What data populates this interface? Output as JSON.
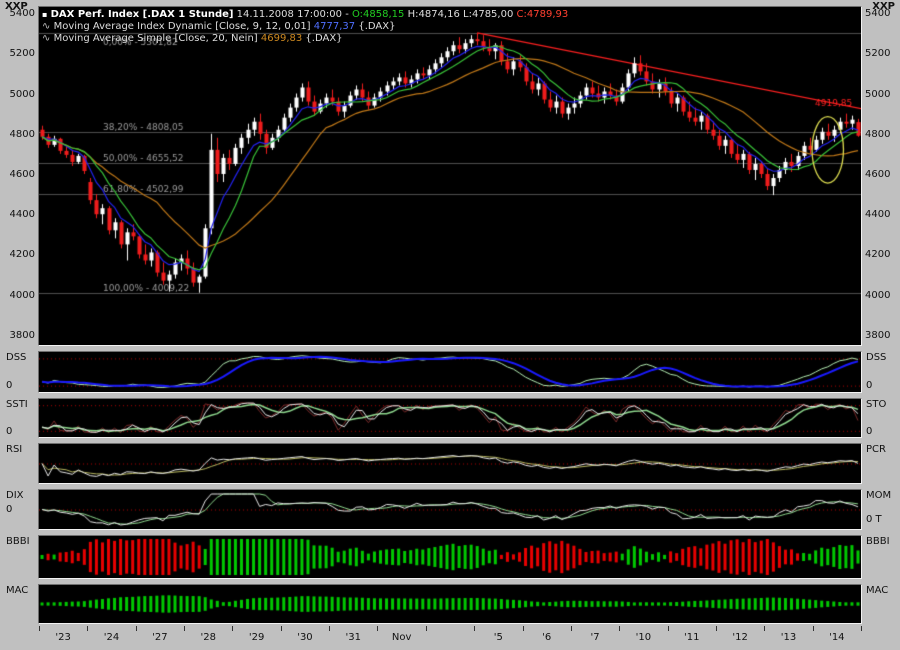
{
  "window": {
    "corner_label": "XXP"
  },
  "icons": {
    "chart": "▪",
    "wave": "∿"
  },
  "header": {
    "title": "DAX Perf. Index [.DAX 1 Stunde]",
    "datetime": "14.11.2008 17:00:00",
    "separator": "-",
    "open": "O:4858,15",
    "high": "H:4874,16",
    "low": "L:4785,00",
    "close": "C:4789,93",
    "ma1": {
      "name": "Moving Average Index Dynamic [Close, 9, 12, 0,01]",
      "value": "4777,37",
      "suffix": "{.DAX}"
    },
    "ma2": {
      "name": "Moving Average Simple [Close, 20, Nein]",
      "value": "4699,83",
      "suffix": "{.DAX}"
    }
  },
  "panel_labels": {
    "zero": "0",
    "dss_left": "DSS",
    "dss_right": "DSS",
    "ssti_left": "SSTI",
    "ssti_right": "STO",
    "rsi_left": "RSI",
    "rsi_right": "PCR",
    "dix_left": "DIX",
    "dix_right": "MOM",
    "dix_right_zero": "0 T",
    "bbbi_left": "BBBI",
    "bbbi_right": "BBBI",
    "mac_left": "MAC",
    "mac_right": "MAC"
  },
  "colors": {
    "background": "#c0c0c0",
    "panel_bg": "#000000",
    "up_candle": "#ffffff",
    "down_candle": "#ee1c1c",
    "ma_fast_blue": "#2222ee",
    "ma_mid_green": "#38c038",
    "ma_slow_orange": "#c07818",
    "fib_line": "#4f4f4f",
    "fib_text": "#9a9a9a",
    "trend": "#ff2020",
    "ellipse": "#dcdc50",
    "dss_blue": "#1a1aff",
    "dss_green": "#b4eeb4",
    "osc_white": "#e6e6e6",
    "osc_green": "#8ed88e",
    "osc_darkred": "#7a2a2a",
    "rsi_second": "#b8b860",
    "hist_green": "#00c800",
    "hist_red": "#e80000",
    "dotted": "#b00000"
  },
  "chart_data": {
    "type": "candlestick",
    "title": "DAX Perf. Index [.DAX 1 Stunde]",
    "interval": "1 Stunde",
    "last_ohlc": {
      "open": 4858.15,
      "high": 4874.16,
      "low": 4785.0,
      "close": 4789.93
    },
    "ylim": [
      3800,
      5400
    ],
    "y_ticks": [
      5400,
      5200,
      5000,
      4800,
      4600,
      4400,
      4200,
      4000,
      3800
    ],
    "candles_per_day": 8,
    "x_labels": [
      {
        "day": 0,
        "text": "'23"
      },
      {
        "day": 1,
        "text": "'24"
      },
      {
        "day": 2,
        "text": "'27"
      },
      {
        "day": 3,
        "text": "'28"
      },
      {
        "day": 4,
        "text": "'29"
      },
      {
        "day": 5,
        "text": "'30"
      },
      {
        "day": 6,
        "text": "'31"
      },
      {
        "day": 7,
        "text": "Nov"
      },
      {
        "day": 9,
        "text": "'5"
      },
      {
        "day": 10,
        "text": "'6"
      },
      {
        "day": 11,
        "text": "'7"
      },
      {
        "day": 12,
        "text": "'10"
      },
      {
        "day": 13,
        "text": "'11"
      },
      {
        "day": 14,
        "text": "'12"
      },
      {
        "day": 15,
        "text": "'13"
      },
      {
        "day": 16,
        "text": "'14"
      }
    ],
    "candles": [
      [
        4820,
        4840,
        4770,
        4785
      ],
      [
        4785,
        4800,
        4730,
        4745
      ],
      [
        4745,
        4790,
        4735,
        4775
      ],
      [
        4775,
        4780,
        4700,
        4715
      ],
      [
        4715,
        4745,
        4680,
        4695
      ],
      [
        4695,
        4720,
        4640,
        4660
      ],
      [
        4660,
        4700,
        4650,
        4690
      ],
      [
        4690,
        4695,
        4600,
        4615
      ],
      [
        4560,
        4580,
        4450,
        4470
      ],
      [
        4470,
        4500,
        4380,
        4400
      ],
      [
        4400,
        4450,
        4350,
        4430
      ],
      [
        4430,
        4440,
        4300,
        4320
      ],
      [
        4320,
        4380,
        4280,
        4360
      ],
      [
        4360,
        4370,
        4230,
        4250
      ],
      [
        4250,
        4330,
        4170,
        4310
      ],
      [
        4310,
        4350,
        4270,
        4290
      ],
      [
        4290,
        4300,
        4180,
        4200
      ],
      [
        4200,
        4250,
        4150,
        4170
      ],
      [
        4170,
        4230,
        4140,
        4210
      ],
      [
        4210,
        4220,
        4090,
        4110
      ],
      [
        4110,
        4160,
        4050,
        4070
      ],
      [
        4070,
        4120,
        4015,
        4100
      ],
      [
        4100,
        4180,
        4080,
        4160
      ],
      [
        4160,
        4200,
        4120,
        4180
      ],
      [
        4180,
        4220,
        4100,
        4130
      ],
      [
        4130,
        4160,
        4040,
        4060
      ],
      [
        4060,
        4100,
        4010,
        4090
      ],
      [
        4090,
        4350,
        4080,
        4330
      ],
      [
        4330,
        4800,
        4300,
        4720
      ],
      [
        4720,
        4780,
        4560,
        4600
      ],
      [
        4600,
        4700,
        4560,
        4680
      ],
      [
        4680,
        4720,
        4620,
        4650
      ],
      [
        4650,
        4750,
        4640,
        4730
      ],
      [
        4730,
        4800,
        4700,
        4780
      ],
      [
        4780,
        4850,
        4750,
        4820
      ],
      [
        4820,
        4880,
        4790,
        4860
      ],
      [
        4860,
        4900,
        4770,
        4800
      ],
      [
        4800,
        4820,
        4700,
        4730
      ],
      [
        4730,
        4800,
        4720,
        4780
      ],
      [
        4780,
        4840,
        4760,
        4820
      ],
      [
        4820,
        4900,
        4810,
        4880
      ],
      [
        4880,
        4950,
        4860,
        4930
      ],
      [
        4930,
        5000,
        4910,
        4980
      ],
      [
        4980,
        5050,
        4960,
        5030
      ],
      [
        5030,
        5060,
        4940,
        4960
      ],
      [
        4960,
        4990,
        4890,
        4910
      ],
      [
        4910,
        4970,
        4900,
        4950
      ],
      [
        4950,
        5000,
        4930,
        4980
      ],
      [
        4980,
        5020,
        4940,
        4960
      ],
      [
        4960,
        4980,
        4890,
        4910
      ],
      [
        4910,
        4960,
        4880,
        4940
      ],
      [
        4940,
        5010,
        4930,
        4990
      ],
      [
        4990,
        5040,
        4970,
        5020
      ],
      [
        5020,
        5050,
        4960,
        4980
      ],
      [
        4980,
        5010,
        4920,
        4940
      ],
      [
        4940,
        5000,
        4930,
        4980
      ],
      [
        4980,
        5030,
        4960,
        5010
      ],
      [
        5010,
        5060,
        4990,
        5040
      ],
      [
        5040,
        5080,
        5020,
        5060
      ],
      [
        5060,
        5100,
        5040,
        5080
      ],
      [
        5080,
        5110,
        5030,
        5050
      ],
      [
        5050,
        5090,
        5030,
        5070
      ],
      [
        5070,
        5120,
        5050,
        5100
      ],
      [
        5100,
        5130,
        5070,
        5090
      ],
      [
        5090,
        5140,
        5070,
        5120
      ],
      [
        5120,
        5170,
        5100,
        5150
      ],
      [
        5150,
        5200,
        5130,
        5180
      ],
      [
        5180,
        5230,
        5160,
        5210
      ],
      [
        5210,
        5260,
        5190,
        5240
      ],
      [
        5240,
        5280,
        5200,
        5220
      ],
      [
        5220,
        5270,
        5200,
        5250
      ],
      [
        5250,
        5290,
        5230,
        5270
      ],
      [
        5270,
        5301,
        5240,
        5260
      ],
      [
        5260,
        5290,
        5210,
        5230
      ],
      [
        5230,
        5270,
        5190,
        5210
      ],
      [
        5210,
        5250,
        5170,
        5240
      ],
      [
        5240,
        5260,
        5140,
        5160
      ],
      [
        5160,
        5200,
        5100,
        5120
      ],
      [
        5120,
        5180,
        5090,
        5160
      ],
      [
        5160,
        5190,
        5110,
        5130
      ],
      [
        5130,
        5150,
        5040,
        5060
      ],
      [
        5060,
        5100,
        5000,
        5020
      ],
      [
        5020,
        5080,
        4990,
        5050
      ],
      [
        5050,
        5060,
        4950,
        4970
      ],
      [
        4970,
        5010,
        4910,
        4930
      ],
      [
        4930,
        4990,
        4900,
        4960
      ],
      [
        4960,
        4980,
        4880,
        4900
      ],
      [
        4900,
        4950,
        4870,
        4930
      ],
      [
        4930,
        4980,
        4900,
        4950
      ],
      [
        4950,
        5010,
        4930,
        4990
      ],
      [
        4990,
        5050,
        4970,
        5030
      ],
      [
        5030,
        5060,
        4980,
        5000
      ],
      [
        5000,
        5040,
        4960,
        4980
      ],
      [
        4980,
        5030,
        4950,
        5010
      ],
      [
        5010,
        5050,
        4970,
        4990
      ],
      [
        4990,
        5020,
        4940,
        4960
      ],
      [
        4960,
        5050,
        4950,
        5030
      ],
      [
        5030,
        5120,
        5010,
        5100
      ],
      [
        5100,
        5180,
        5080,
        5150
      ],
      [
        5150,
        5190,
        5090,
        5110
      ],
      [
        5110,
        5150,
        5040,
        5060
      ],
      [
        5060,
        5100,
        5000,
        5020
      ],
      [
        5020,
        5070,
        4980,
        5050
      ],
      [
        5050,
        5080,
        4990,
        5010
      ],
      [
        5010,
        5030,
        4930,
        4950
      ],
      [
        4950,
        5000,
        4910,
        4980
      ],
      [
        4980,
        4990,
        4890,
        4910
      ],
      [
        4910,
        4960,
        4860,
        4880
      ],
      [
        4880,
        4930,
        4840,
        4860
      ],
      [
        4860,
        4910,
        4820,
        4890
      ],
      [
        4890,
        4900,
        4800,
        4820
      ],
      [
        4820,
        4860,
        4770,
        4790
      ],
      [
        4790,
        4820,
        4720,
        4740
      ],
      [
        4740,
        4790,
        4700,
        4770
      ],
      [
        4770,
        4780,
        4680,
        4700
      ],
      [
        4700,
        4750,
        4650,
        4670
      ],
      [
        4670,
        4720,
        4630,
        4700
      ],
      [
        4700,
        4710,
        4600,
        4620
      ],
      [
        4620,
        4680,
        4570,
        4650
      ],
      [
        4650,
        4660,
        4580,
        4600
      ],
      [
        4600,
        4630,
        4520,
        4540
      ],
      [
        4540,
        4600,
        4495,
        4580
      ],
      [
        4580,
        4640,
        4560,
        4620
      ],
      [
        4620,
        4680,
        4600,
        4660
      ],
      [
        4660,
        4700,
        4610,
        4640
      ],
      [
        4640,
        4710,
        4620,
        4690
      ],
      [
        4690,
        4760,
        4670,
        4740
      ],
      [
        4740,
        4780,
        4700,
        4720
      ],
      [
        4720,
        4790,
        4710,
        4770
      ],
      [
        4770,
        4830,
        4750,
        4810
      ],
      [
        4810,
        4850,
        4770,
        4790
      ],
      [
        4790,
        4840,
        4760,
        4820
      ],
      [
        4820,
        4880,
        4800,
        4860
      ],
      [
        4860,
        4900,
        4830,
        4850
      ],
      [
        4850,
        4890,
        4820,
        4870
      ],
      [
        4858,
        4874,
        4785,
        4790
      ]
    ],
    "moving_averages": [
      {
        "name": "Moving Average Index Dynamic [Close, 9, 12, 0,01]",
        "value": 4777.37,
        "color_key": "ma_fast_blue"
      },
      {
        "name": "Moving Average Simple [Close, 20, Nein]",
        "value": 4699.83,
        "color_key": "ma_slow_orange"
      }
    ],
    "fib_levels": [
      {
        "label": "0,00% - 5301,82",
        "value": 5301.82
      },
      {
        "label": "38,20% - 4808,05",
        "value": 4808.05
      },
      {
        "label": "50,00% - 4655,52",
        "value": 4655.52
      },
      {
        "label": "61,80% - 4502,99",
        "value": 4502.99
      },
      {
        "label": "100,00% - 4009,22",
        "value": 4009.22
      }
    ],
    "trendline": {
      "from_candle": 72,
      "from_value": 5301.82,
      "to_candle": 135,
      "to_value": 4919.85,
      "label": "4919,85"
    },
    "ellipse": {
      "center_candle": 130,
      "center_value": 4720,
      "rx_candles": 2.6,
      "ry_value": 165
    },
    "indicator_panels": [
      {
        "left": "DSS",
        "right": "DSS",
        "type": "double-smoothed stochastic, blue slow line + light green fast line, dotted bands",
        "range": [
          0,
          100
        ]
      },
      {
        "left": "SSTI",
        "right": "STO",
        "type": "fast stochastic, white + green jagged lines",
        "range": [
          0,
          100
        ]
      },
      {
        "left": "RSI",
        "right": "PCR",
        "type": "RSI line with dotted midline",
        "range": [
          0,
          100
        ]
      },
      {
        "left": "DIX",
        "right": "MOM",
        "type": "momentum oscillator around dotted zero line",
        "zero": 0
      },
      {
        "left": "BBBI",
        "right": "BBBI",
        "type": "histogram, red below / green above moving average",
        "zero": 0
      },
      {
        "left": "MAC",
        "right": "MAC",
        "type": "green MACD-strength histogram",
        "zero": 0
      }
    ]
  }
}
